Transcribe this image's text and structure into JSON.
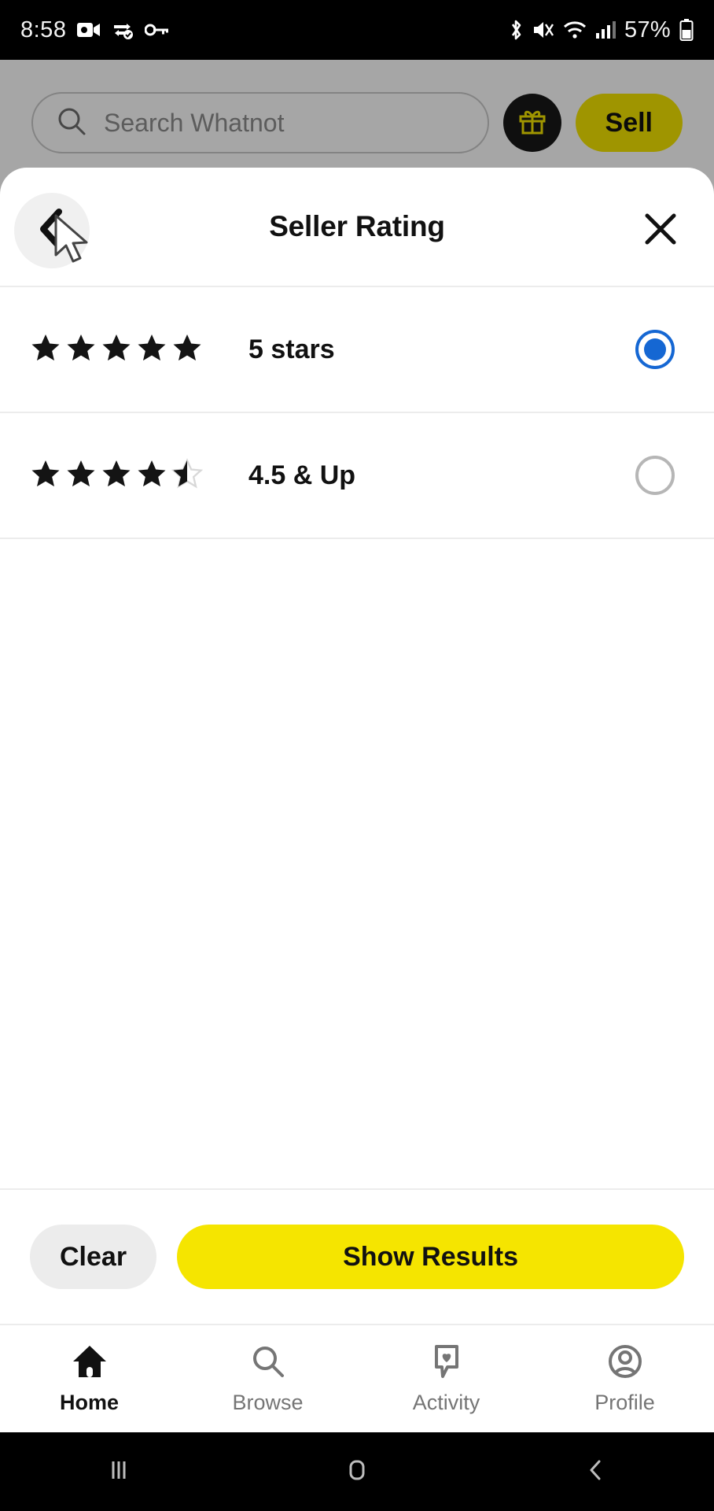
{
  "status_bar": {
    "time": "8:58",
    "battery_text": "57%",
    "left_icons": [
      "video-camera-icon",
      "vpn-icon",
      "key-icon"
    ],
    "right_icons": [
      "bluetooth-icon",
      "mute-icon",
      "wifi-icon",
      "cellular-signal-icon",
      "battery-icon"
    ]
  },
  "app_header": {
    "search_placeholder": "Search Whatnot",
    "search_value": "",
    "gift_icon": "gift-icon",
    "sell_label": "Sell"
  },
  "sheet": {
    "title": "Seller Rating",
    "back_icon": "chevron-left-icon",
    "close_icon": "close-icon",
    "options": [
      {
        "label": "5 stars",
        "stars": 5,
        "half": false,
        "selected": true
      },
      {
        "label": "4.5 & Up",
        "stars": 4,
        "half": true,
        "selected": false
      }
    ]
  },
  "actions": {
    "clear_label": "Clear",
    "show_results_label": "Show Results"
  },
  "tabbar": {
    "items": [
      {
        "label": "Home",
        "icon": "home-icon",
        "active": true
      },
      {
        "label": "Browse",
        "icon": "search-icon",
        "active": false
      },
      {
        "label": "Activity",
        "icon": "activity-heart-bubble-icon",
        "active": false
      },
      {
        "label": "Profile",
        "icon": "profile-icon",
        "active": false
      }
    ]
  },
  "system_nav": {
    "recents_icon": "recents-icon",
    "home_icon": "home-square-icon",
    "back_icon": "back-chevron-icon"
  },
  "colors": {
    "brand_yellow": "#f5e500",
    "selected_blue": "#1567d3",
    "star_filled": "#141414",
    "star_empty": "#d8d8d8"
  }
}
